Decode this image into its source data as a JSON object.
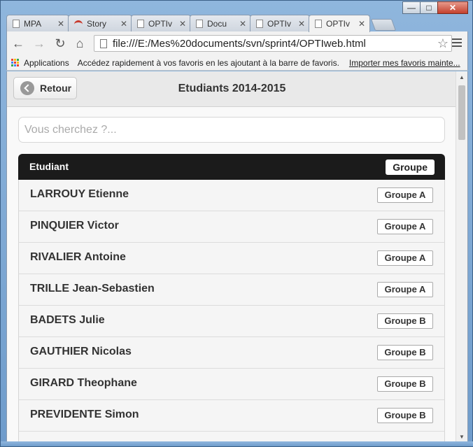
{
  "window": {
    "controls": [
      "minimize",
      "maximize",
      "close"
    ]
  },
  "tabs": [
    {
      "label": "MPA",
      "icon": "page-icon",
      "active": false
    },
    {
      "label": "Story",
      "icon": "story-icon",
      "active": false
    },
    {
      "label": "OPTIv",
      "icon": "page-icon",
      "active": false
    },
    {
      "label": "Docu",
      "icon": "page-icon",
      "active": false
    },
    {
      "label": "OPTIv",
      "icon": "page-icon",
      "active": false
    },
    {
      "label": "OPTIv",
      "icon": "page-icon",
      "active": true
    }
  ],
  "toolbar": {
    "url": "file:///E:/Mes%20documents/svn/sprint4/OPTIweb.html"
  },
  "bookmarks": {
    "apps_label": "Applications",
    "hint": "Accédez rapidement à vos favoris en les ajoutant à la barre de favoris.",
    "import_link": "Importer mes favoris mainte..."
  },
  "page": {
    "back_label": "Retour",
    "title": "Etudiants 2014-2015",
    "search_placeholder": "Vous cherchez ?...",
    "list_header": "Etudiant",
    "group_header_button": "Groupe",
    "students": [
      {
        "name": "LARROUY Etienne",
        "group": "Groupe A"
      },
      {
        "name": "PINQUIER Victor",
        "group": "Groupe A"
      },
      {
        "name": "RIVALIER Antoine",
        "group": "Groupe A"
      },
      {
        "name": "TRILLE Jean-Sebastien",
        "group": "Groupe A"
      },
      {
        "name": "BADETS Julie",
        "group": "Groupe B"
      },
      {
        "name": "GAUTHIER Nicolas",
        "group": "Groupe B"
      },
      {
        "name": "GIRARD Theophane",
        "group": "Groupe B"
      },
      {
        "name": "PREVIDENTE Simon",
        "group": "Groupe B"
      }
    ]
  },
  "colors": {
    "list_header_bg": "#1b1b1b",
    "row_bg": "#f5f5f5",
    "header_bg": "#e9e9e9"
  }
}
